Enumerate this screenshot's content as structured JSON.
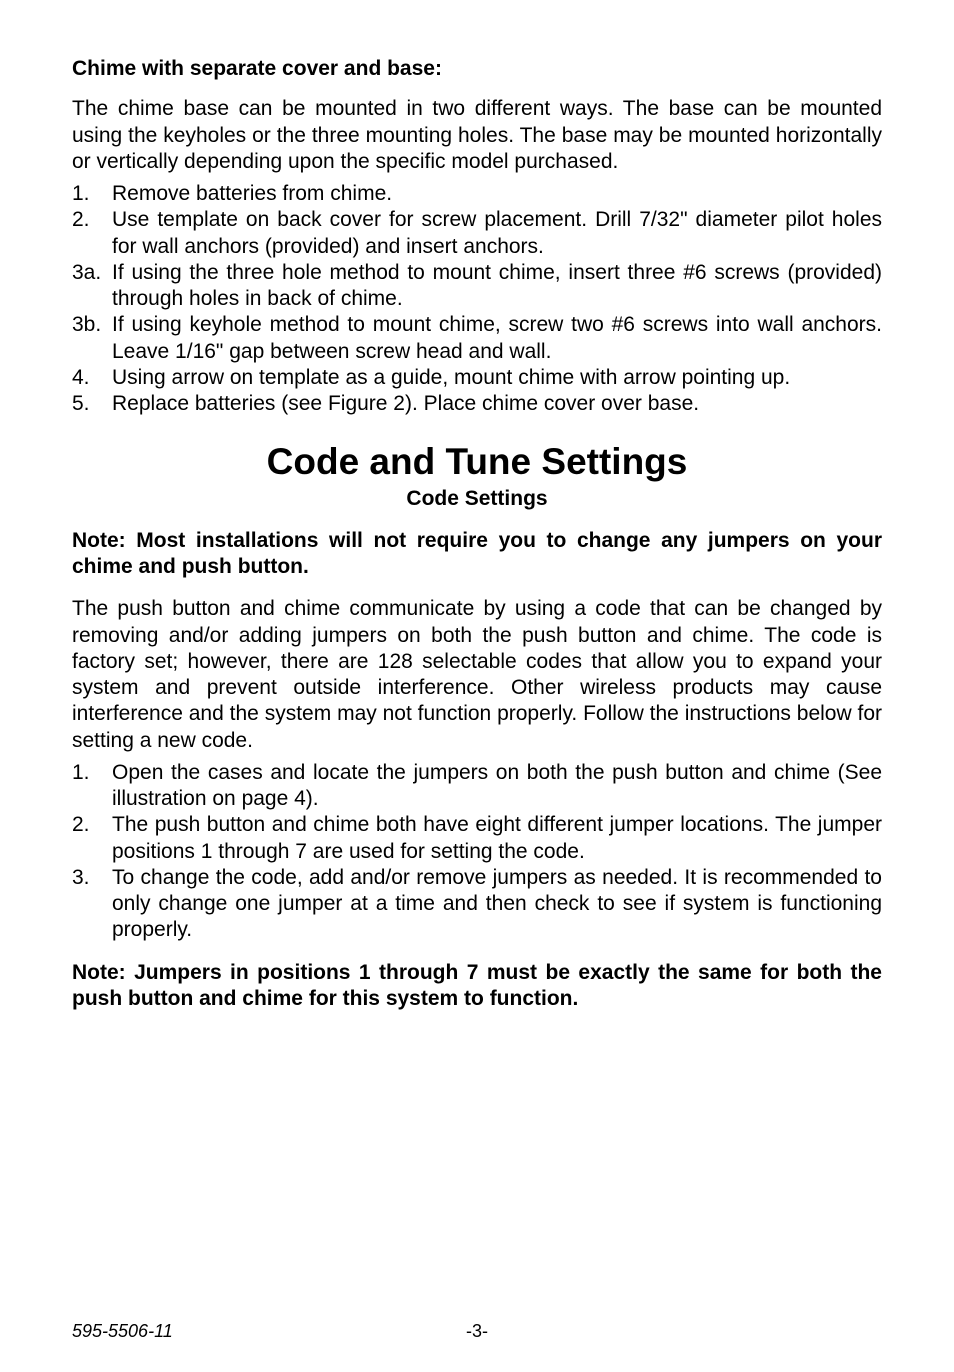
{
  "sections": {
    "chime_separate": {
      "heading": "Chime with separate cover and base:",
      "intro": "The chime base can be mounted in two different ways. The base can be mounted using the keyholes or the three mounting holes. The base may be mounted horizontally or vertically depending upon the specific model purchased.",
      "items": [
        {
          "num": "1.",
          "text": "Remove batteries from chime."
        },
        {
          "num": "2.",
          "text": "Use template on back cover for screw placement. Drill 7/32\" diameter pilot holes for wall anchors (provided) and insert anchors."
        },
        {
          "num": "3a.",
          "text": "If using the three hole method to mount chime, insert three #6 screws (provided) through holes in back of chime."
        },
        {
          "num": "3b.",
          "text": "If using keyhole method to mount chime, screw two #6 screws into wall anchors. Leave 1/16\" gap between screw head and wall."
        },
        {
          "num": "4.",
          "text": "Using arrow on template as a guide, mount chime with arrow pointing up."
        },
        {
          "num": "5.",
          "text": "Replace batteries (see Figure 2). Place chime cover over base."
        }
      ]
    },
    "code_tune": {
      "heading": "Code and Tune Settings",
      "subheading": "Code Settings",
      "note1": "Note: Most installations will not require you to change any jumpers on your chime and push button.",
      "intro": "The push button and chime communicate by using a code that can be changed by removing and/or adding jumpers on both the push button and chime. The code is factory set; however, there are 128 selectable codes that allow you to expand your system and prevent outside interference. Other wireless products may cause interference and the system may not function properly. Follow the instructions below for setting a new code.",
      "items": [
        {
          "num": "1.",
          "text": "Open the cases and locate the jumpers on both the push button and chime (See illustration on page 4)."
        },
        {
          "num": "2.",
          "text": "The push button and chime both have eight different jumper locations. The jumper positions 1 through 7 are used for setting the code."
        },
        {
          "num": "3.",
          "text": "To change the code, add and/or remove jumpers as needed. It is recommended to only change one jumper at a time and then check to see if system is functioning properly."
        }
      ],
      "note2": "Note: Jumpers in positions 1 through 7 must be exactly the same for both the push button and chime for this system to function."
    }
  },
  "footer": {
    "left": "595-5506-11",
    "center": "-3-"
  }
}
